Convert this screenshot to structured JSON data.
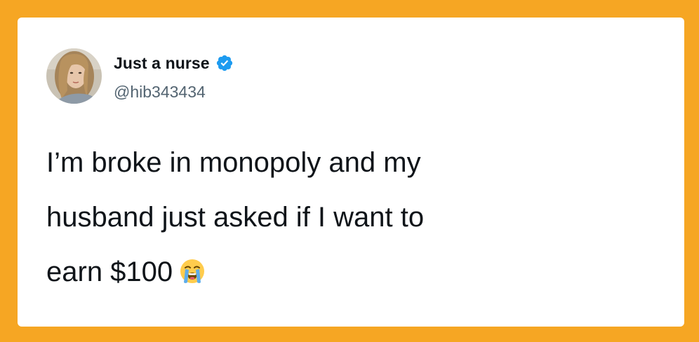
{
  "tweet": {
    "author": {
      "display_name": "Just a nurse",
      "handle": "@hib343434",
      "verified": true,
      "avatar_icon": "profile-photo"
    },
    "text_lines": [
      "I’m broke in monopoly and my",
      "husband just asked if I want to",
      "earn $100"
    ],
    "emoji": "loudly-crying-face-icon"
  },
  "colors": {
    "background": "#F6A623",
    "card": "#FFFFFF",
    "text": "#0F1419",
    "secondary_text": "#536471",
    "verified_badge": "#1D9BF0"
  }
}
